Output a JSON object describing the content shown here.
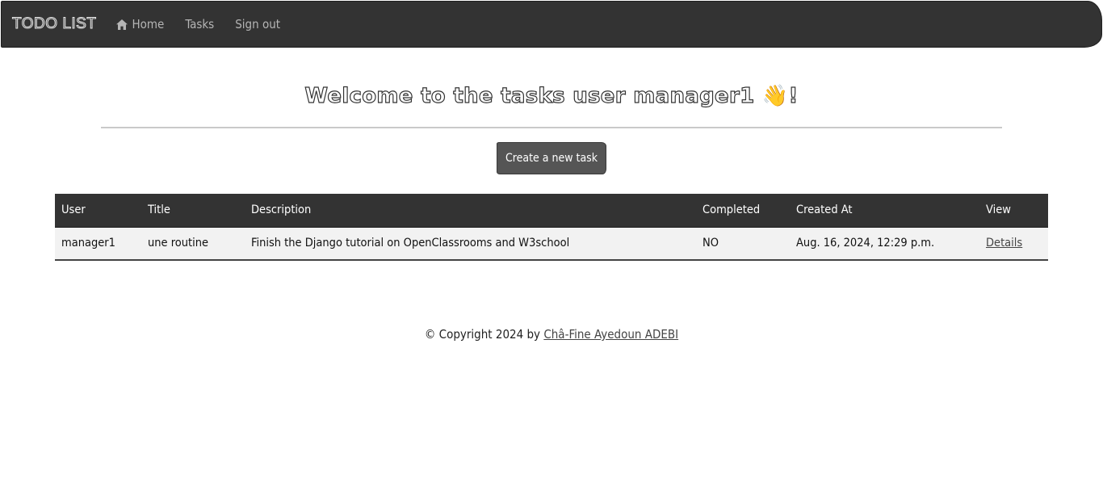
{
  "navbar": {
    "brand": "TODO LIST",
    "home_label": "Home",
    "tasks_label": "Tasks",
    "signout_label": "Sign out",
    "home_icon": "home-icon"
  },
  "main": {
    "title_text": "Welcome to the tasks user manager1 ",
    "title_emoji": "👋",
    "title_suffix": "!",
    "create_button_label": "Create a new task"
  },
  "table": {
    "headers": [
      "User",
      "Title",
      "Description",
      "Completed",
      "Created At",
      "View"
    ],
    "rows": [
      {
        "user": "manager1",
        "title": "une routine",
        "description": "Finish the Django tutorial on OpenClassrooms and W3school",
        "completed": "NO",
        "created_at": "Aug. 16, 2024, 12:29 p.m.",
        "view_link": "Details"
      }
    ]
  },
  "footer": {
    "copyright_text": "© Copyright 2024 by ",
    "author": "Châ-Fine Ayedoun ADEBI"
  },
  "colors": {
    "navbar_bg": "#333333",
    "button_bg": "#555555",
    "table_header_bg": "#333333",
    "row_bg": "#f2f2f2"
  }
}
